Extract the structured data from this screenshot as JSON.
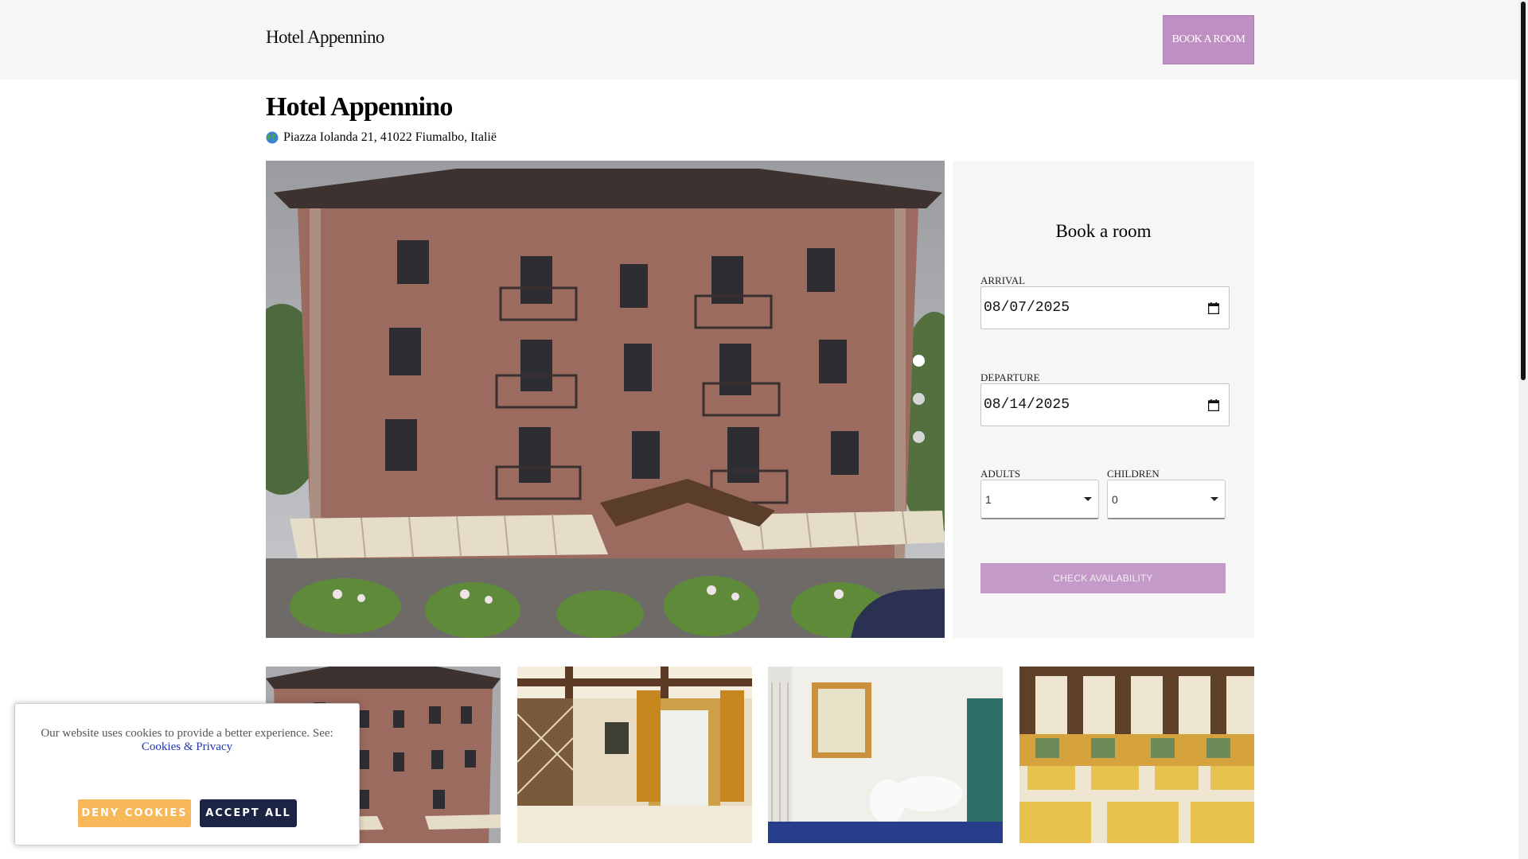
{
  "header": {
    "brand": "Hotel Appennino",
    "book_button": "BOOK A ROOM"
  },
  "hotel": {
    "name": "Hotel Appennino",
    "address_icon": "globe-icon",
    "address": "Piazza Iolanda 21, 41022 Fiumalbo, Italië"
  },
  "carousel": {
    "dots": 3,
    "active_index": 0
  },
  "booking": {
    "title": "Book a room",
    "arrival_label": "ARRIVAL",
    "arrival_value": "08/07/2025",
    "departure_label": "DEPARTURE",
    "departure_value": "08/14/2025",
    "adults_label": "ADULTS",
    "adults_value": "1",
    "children_label": "CHILDREN",
    "children_value": "0",
    "check_button": "CHECK AVAILABILITY"
  },
  "gallery": [
    "hotel-exterior",
    "dining-room",
    "bathroom",
    "restaurant-hall"
  ],
  "cookies": {
    "message": "Our website uses cookies to provide a better experience. See:",
    "link": "Cookies & Privacy",
    "deny": "DENY COOKIES",
    "accept": "ACCEPT ALL"
  },
  "colors": {
    "accent": "#bf8ec3",
    "check_button": "#c49ac8",
    "deny": "#f7b85a",
    "accept": "#1b2443",
    "panel_bg": "#f7f6f6"
  }
}
